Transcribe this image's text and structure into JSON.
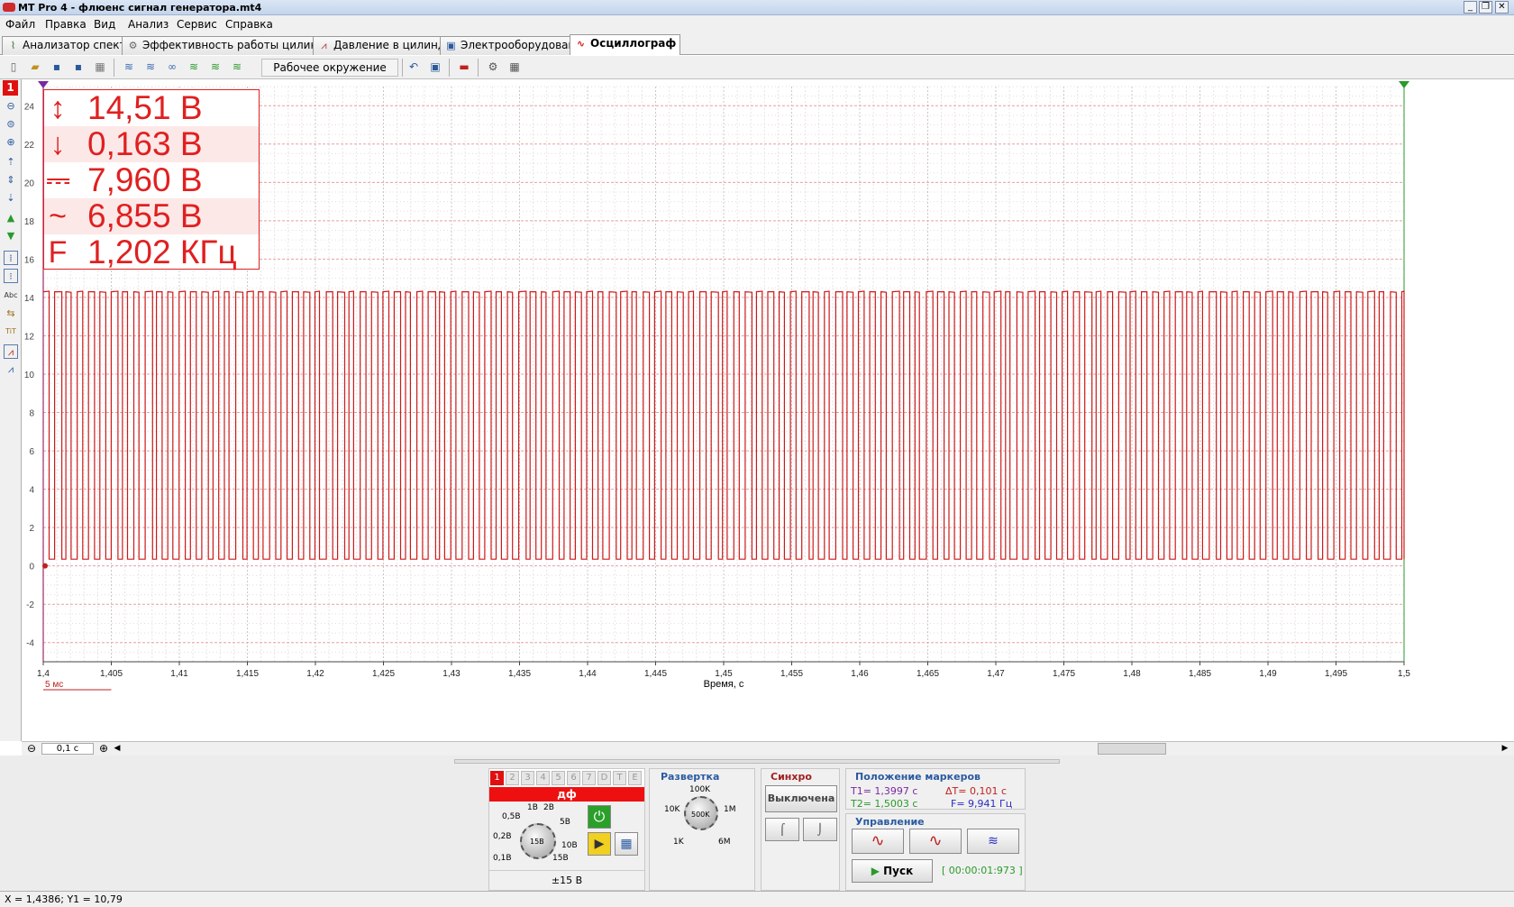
{
  "window": {
    "title": "MT Pro 4 - флюенс сигнал генератора.mt4",
    "minimize": "_",
    "restore": "❐",
    "close": "✕"
  },
  "menu": [
    "Файл",
    "Правка",
    "Вид",
    "Анализ",
    "Сервис",
    "Справка"
  ],
  "tabs": [
    {
      "label": "Анализатор спектра",
      "icon": "spectrum-icon",
      "active": false
    },
    {
      "label": "Эффективность работы цилиндров",
      "icon": "gear-icon",
      "active": false
    },
    {
      "label": "Давление в цилиндре",
      "icon": "pressure-icon",
      "active": false
    },
    {
      "label": "Электрооборудование",
      "icon": "electric-icon",
      "active": false
    },
    {
      "label": "Осциллограф",
      "icon": "sine-icon",
      "active": true
    }
  ],
  "toolbar": {
    "workenv_label": "Рабочее окружение"
  },
  "left_tools": {
    "channel": "1"
  },
  "readout": [
    {
      "icon": "↕",
      "label": "max",
      "value": "14,51 В"
    },
    {
      "icon": "↓",
      "label": "min",
      "value": "0,163 В"
    },
    {
      "icon": "⎓",
      "label": "dc",
      "value": "7,960 В"
    },
    {
      "icon": "~",
      "label": "ac",
      "value": "6,855 В"
    },
    {
      "icon": "F",
      "label": "freq",
      "value": "1,202 КГц"
    }
  ],
  "chart_data": {
    "type": "line",
    "xlabel": "Время, с",
    "xlim": [
      1.4,
      1.5
    ],
    "ylim": [
      -5,
      25
    ],
    "x_ticks": [
      "1,4",
      "1,405",
      "1,41",
      "1,415",
      "1,42",
      "1,425",
      "1,43",
      "1,435",
      "1,44",
      "1,445",
      "1,45",
      "1,455",
      "1,46",
      "1,465",
      "1,47",
      "1,475",
      "1,48",
      "1,485",
      "1,49",
      "1,495",
      "1,5"
    ],
    "y_ticks": [
      "24",
      "22",
      "20",
      "18",
      "16",
      "14",
      "12",
      "10",
      "8",
      "6",
      "4",
      "2",
      "0",
      "-2",
      "-4"
    ],
    "series": [
      {
        "color": "#cc1a1a",
        "waveform": "square",
        "frequency_hz": 1202,
        "high_v": 14.3,
        "low_v": 0.35
      }
    ],
    "scale_label": "5 мс",
    "grid": true
  },
  "hscroll": {
    "zoom": "0,1 с"
  },
  "channel_panel": {
    "tabs": [
      "1",
      "2",
      "3",
      "4",
      "5",
      "6",
      "7",
      "D",
      "T",
      "E"
    ],
    "name": "дф",
    "knob_labels": [
      "0,1В",
      "0,2В",
      "0,5В",
      "1В",
      "2В",
      "5В",
      "10В",
      "15В",
      "15В"
    ],
    "range": "±15 В"
  },
  "sweep": {
    "title": "Развертка",
    "labels": [
      "10K",
      "100K",
      "1M",
      "6M",
      "1K",
      "500K"
    ]
  },
  "sync": {
    "title": "Синхро",
    "button": "Выключена"
  },
  "markers": {
    "title": "Положение маркеров",
    "t1": "T1= 1,3997 с",
    "dt": "ΔT= 0,101 с",
    "t2": "T2= 1,5003 с",
    "f": "F= 9,941 Гц"
  },
  "control": {
    "title": "Управление",
    "start": "Пуск",
    "time": "[ 00:00:01:973 ]"
  },
  "status": "X = 1,4386; Y1 = 10,79"
}
